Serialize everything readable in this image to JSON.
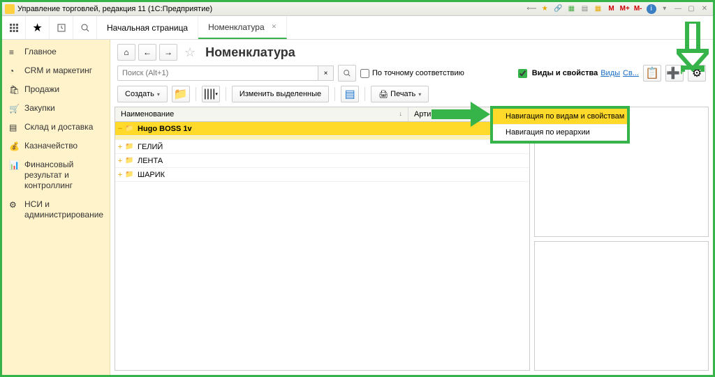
{
  "titlebar": {
    "text": "Управление торговлей, редакция 11 (1С:Предприятие)"
  },
  "tabs": {
    "home": "Начальная страница",
    "nomenclature": "Номенклатура"
  },
  "sidebar": {
    "items": [
      {
        "label": "Главное"
      },
      {
        "label": "CRM и маркетинг"
      },
      {
        "label": "Продажи"
      },
      {
        "label": "Закупки"
      },
      {
        "label": "Склад и доставка"
      },
      {
        "label": "Казначейство"
      },
      {
        "label": "Финансовый результат и\nконтроллинг"
      },
      {
        "label": "НСИ и\nадминистрирование"
      }
    ]
  },
  "page": {
    "title": "Номенклатура"
  },
  "search": {
    "placeholder": "Поиск (Alt+1)"
  },
  "exact_match": "По точному соответствию",
  "types_panel": {
    "label": "Виды и свойства",
    "link1": "Виды",
    "link2": "Св..."
  },
  "actions": {
    "create": "Создать",
    "change_selected": "Изменить выделенные",
    "print": "Печать"
  },
  "grid": {
    "col1": "Наименование",
    "col2": "Артикул",
    "rows": [
      {
        "name": "Hugo BOSS 1v"
      },
      {
        "name": "ГЕЛИЙ"
      },
      {
        "name": "ЛЕНТА"
      },
      {
        "name": "ШАРИК"
      }
    ]
  },
  "menu": {
    "item1": "Навигация по видам и свойствам",
    "item2": "Навигация по иерархии"
  }
}
